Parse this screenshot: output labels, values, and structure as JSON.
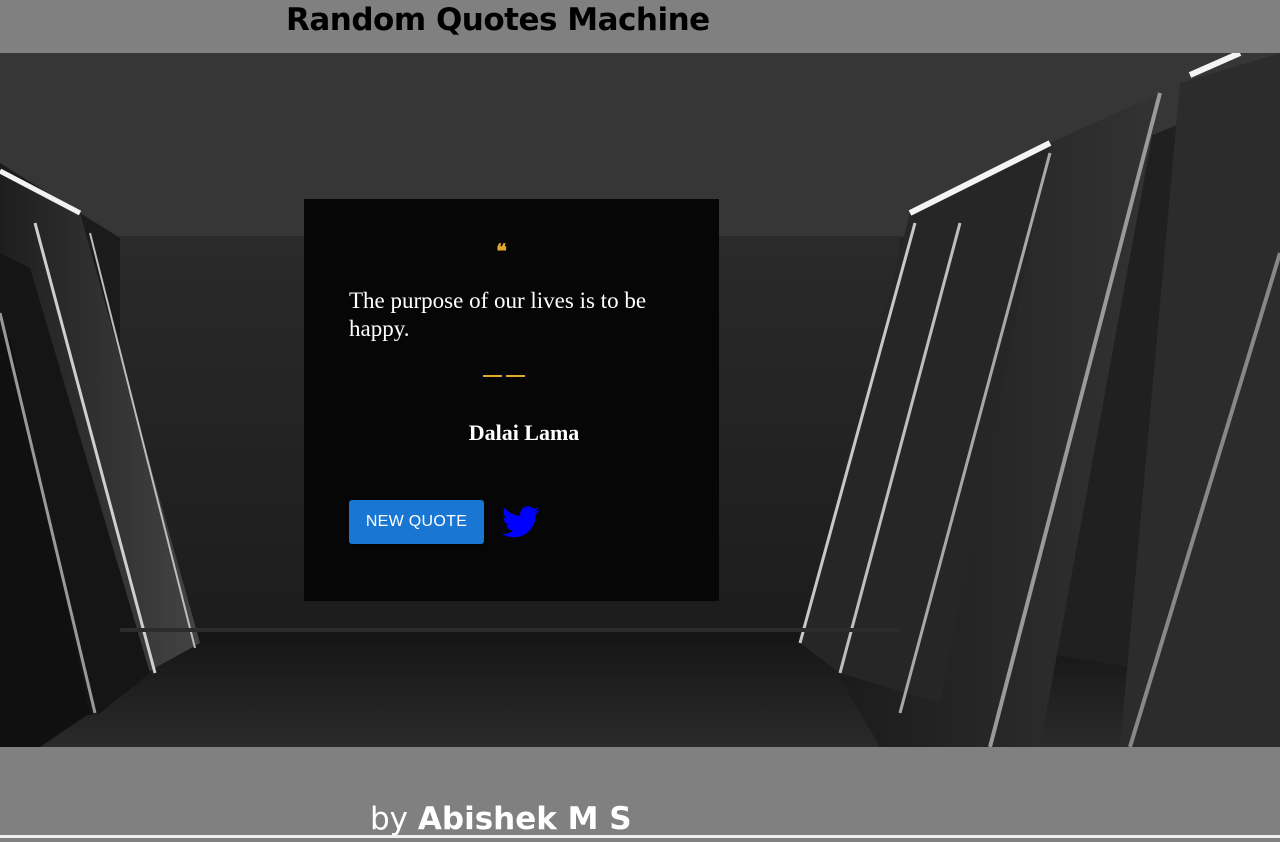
{
  "header": {
    "title": "Random Quotes Machine"
  },
  "quote": {
    "mark": "❝",
    "text": "The purpose of our lives is to be happy.",
    "author": "Dalai Lama"
  },
  "actions": {
    "new_quote_label": "NEW QUOTE",
    "twitter_icon": "twitter-bird-icon"
  },
  "footer": {
    "by": "by ",
    "name": "Abishek M S"
  },
  "colors": {
    "accent": "#e0a82e",
    "button": "#1976d2",
    "twitter": "#0000ff",
    "page_bg": "#808080",
    "card_bg": "#060606"
  }
}
